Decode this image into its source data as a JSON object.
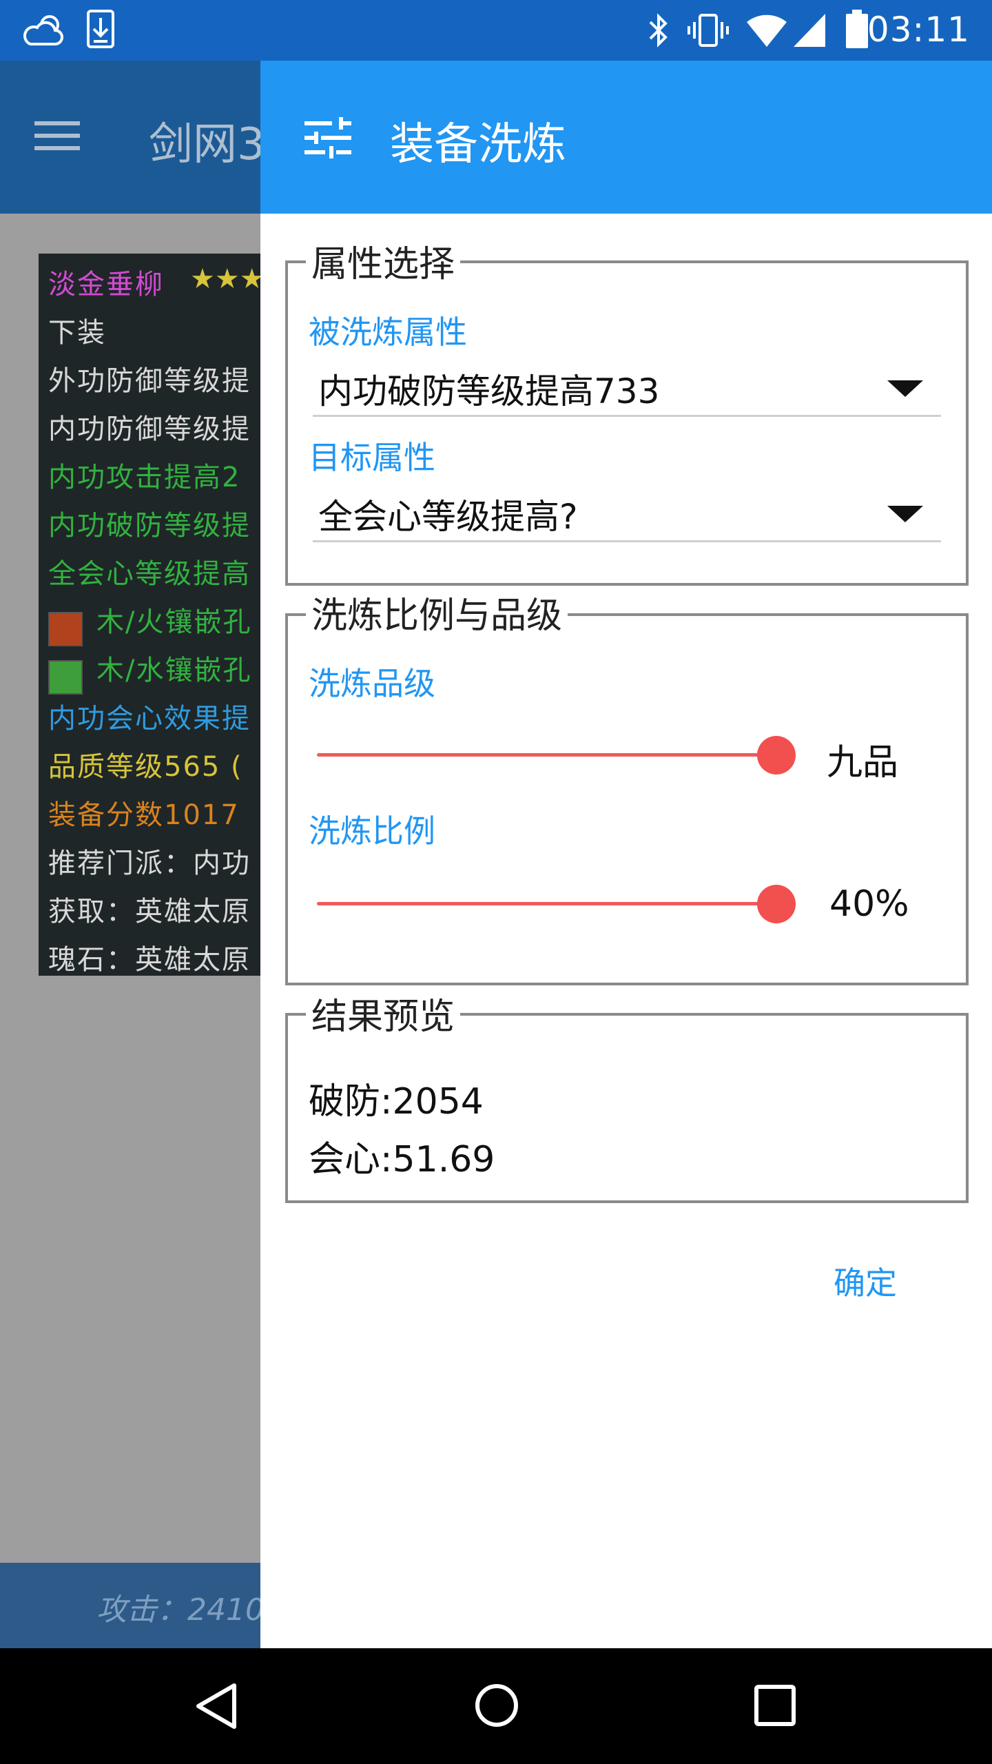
{
  "status_bar": {
    "time": "03:11"
  },
  "background": {
    "title": "剑网3",
    "lines": [
      {
        "text": "淡金垂柳",
        "color": "#d24ad2"
      },
      {
        "text": "下装",
        "color": "#d8d8d8"
      },
      {
        "text": "外功防御等级提",
        "color": "#d8d8d8"
      },
      {
        "text": "内功防御等级提",
        "color": "#d8d8d8"
      },
      {
        "text": "内功攻击提高2",
        "color": "#31b23f"
      },
      {
        "text": "内功破防等级提",
        "color": "#31b23f"
      },
      {
        "text": "全会心等级提高",
        "color": "#31b23f"
      },
      {
        "text": "木/火镶嵌孔",
        "color": "#31b23f"
      },
      {
        "text": "木/水镶嵌孔",
        "color": "#31b23f"
      },
      {
        "text": "内功会心效果提",
        "color": "#2f9ce0"
      },
      {
        "text": "品质等级565 (",
        "color": "#d6c43a"
      },
      {
        "text": "装备分数1017",
        "color": "#d8831f"
      },
      {
        "text": "推荐门派：内功",
        "color": "#d8d8d8"
      },
      {
        "text": "获取：英雄太原",
        "color": "#d8d8d8"
      },
      {
        "text": "瑰石：英雄太原",
        "color": "#d8d8d8"
      }
    ],
    "stars": "★★★",
    "footer": "攻击：2410"
  },
  "drawer": {
    "title": "装备洗炼",
    "icon": "tune-icon",
    "attr_section": {
      "legend": "属性选择",
      "source_label": "被洗炼属性",
      "source_value": "内功破防等级提高733",
      "target_label": "目标属性",
      "target_value": "全会心等级提高?"
    },
    "ratio_section": {
      "legend": "洗炼比例与品级",
      "grade_label": "洗炼品级",
      "grade_value": "九品",
      "grade_level": 1.0,
      "ratio_label": "洗炼比例",
      "ratio_value": "40%",
      "ratio_level": 1.0
    },
    "result_section": {
      "legend": "结果预览",
      "line1": "破防:2054",
      "line2": "会心:51.69"
    },
    "confirm": "确定"
  },
  "colors": {
    "accent": "#2196f3",
    "slider": "#f24f4f",
    "status_bar": "#1565c0"
  }
}
